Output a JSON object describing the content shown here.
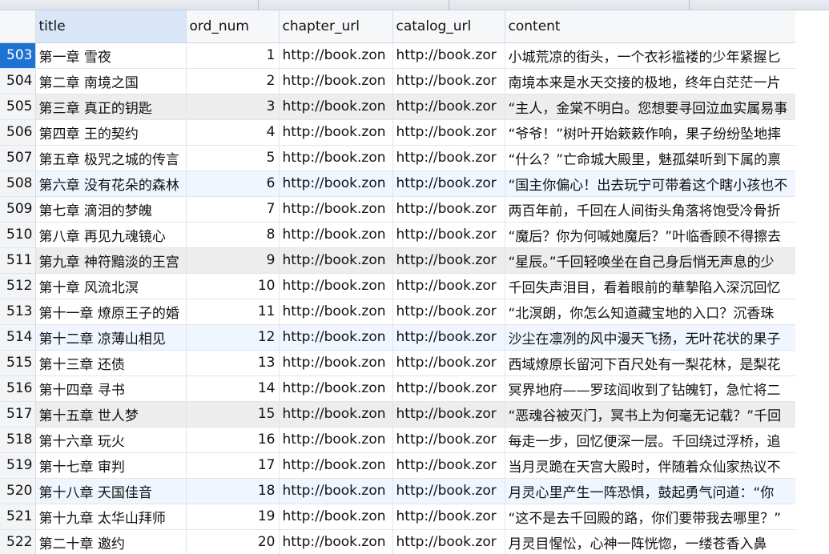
{
  "toolbar": {
    "fragments": [
      "",
      "",
      ""
    ]
  },
  "columns": [
    "",
    "title",
    "ord_num",
    "chapter_url",
    "catalog_url",
    "content"
  ],
  "rows": [
    {
      "id": "503",
      "title": "第一章 雪夜",
      "ord": "1",
      "chapter_url": "http://book.zon",
      "catalog_url": "http://book.zor",
      "content": "小城荒凉的街头，一个衣衫褴褛的少年紧握匕",
      "style": "sel"
    },
    {
      "id": "504",
      "title": "第二章 南境之国",
      "ord": "2",
      "chapter_url": "http://book.zon",
      "catalog_url": "http://book.zor",
      "content": "南境本来是水天交接的极地，终年白茫茫一片",
      "style": ""
    },
    {
      "id": "505",
      "title": "第三章 真正的钥匙",
      "ord": "3",
      "chapter_url": "http://book.zon",
      "catalog_url": "http://book.zor",
      "content": "“主人，金棠不明白。您想要寻回泣血实属易事",
      "style": "grey"
    },
    {
      "id": "506",
      "title": "第四章 王的契约",
      "ord": "4",
      "chapter_url": "http://book.zon",
      "catalog_url": "http://book.zor",
      "content": "“爷爷！”树叶开始簌簌作响，果子纷纷坠地摔",
      "style": ""
    },
    {
      "id": "507",
      "title": "第五章 极咒之城的传言",
      "ord": "5",
      "chapter_url": "http://book.zon",
      "catalog_url": "http://book.zor",
      "content": "“什么？”亡命城大殿里，魅孤桀听到下属的禀",
      "style": ""
    },
    {
      "id": "508",
      "title": "第六章 没有花朵的森林",
      "ord": "6",
      "chapter_url": "http://book.zon",
      "catalog_url": "http://book.zor",
      "content": "“国主你偏心！出去玩宁可带着这个瞎小孩也不",
      "style": "alt"
    },
    {
      "id": "509",
      "title": "第七章 滴泪的梦魄",
      "ord": "7",
      "chapter_url": "http://book.zon",
      "catalog_url": "http://book.zor",
      "content": "两百年前，千回在人间街头角落将饱受冷骨折",
      "style": ""
    },
    {
      "id": "510",
      "title": "第八章 再见九魂镜心",
      "ord": "8",
      "chapter_url": "http://book.zon",
      "catalog_url": "http://book.zor",
      "content": "“魔后？你为何喊她魔后？”叶临香顾不得擦去",
      "style": ""
    },
    {
      "id": "511",
      "title": "第九章 神符黯淡的王宫",
      "ord": "9",
      "chapter_url": "http://book.zon",
      "catalog_url": "http://book.zor",
      "content": "“星辰。”千回轻唤坐在自己身后悄无声息的少",
      "style": "grey"
    },
    {
      "id": "512",
      "title": "第十章 风流北溟",
      "ord": "10",
      "chapter_url": "http://book.zon",
      "catalog_url": "http://book.zor",
      "content": "千回失声泪目，看着眼前的華摯陷入深沉回忆",
      "style": ""
    },
    {
      "id": "513",
      "title": "第十一章 燎原王子的婚",
      "ord": "11",
      "chapter_url": "http://book.zon",
      "catalog_url": "http://book.zor",
      "content": "“北溟朗，你怎么知道藏宝地的入口？沉香珠",
      "style": ""
    },
    {
      "id": "514",
      "title": "第十二章 凉薄山相见",
      "ord": "12",
      "chapter_url": "http://book.zon",
      "catalog_url": "http://book.zor",
      "content": "沙尘在凛冽的风中漫天飞扬，无叶花状的果子",
      "style": "alt"
    },
    {
      "id": "515",
      "title": "第十三章 还债",
      "ord": "13",
      "chapter_url": "http://book.zon",
      "catalog_url": "http://book.zor",
      "content": "西域燎原长留河下百尺处有一梨花林，是梨花",
      "style": ""
    },
    {
      "id": "516",
      "title": "第十四章 寻书",
      "ord": "14",
      "chapter_url": "http://book.zon",
      "catalog_url": "http://book.zor",
      "content": "冥界地府——罗玹阎收到了钻魄钉，急忙将二",
      "style": ""
    },
    {
      "id": "517",
      "title": "第十五章 世人梦",
      "ord": "15",
      "chapter_url": "http://book.zon",
      "catalog_url": "http://book.zor",
      "content": "“恶魂谷被灭门，冥书上为何毫无记载？”千回",
      "style": "grey"
    },
    {
      "id": "518",
      "title": "第十六章 玩火",
      "ord": "16",
      "chapter_url": "http://book.zon",
      "catalog_url": "http://book.zor",
      "content": "每走一步，回忆便深一层。千回绕过浮桥，追",
      "style": ""
    },
    {
      "id": "519",
      "title": "第十七章 审判",
      "ord": "17",
      "chapter_url": "http://book.zon",
      "catalog_url": "http://book.zor",
      "content": "当月灵跪在天宫大殿时，伴随着众仙家热议不",
      "style": ""
    },
    {
      "id": "520",
      "title": "第十八章 天国佳音",
      "ord": "18",
      "chapter_url": "http://book.zon",
      "catalog_url": "http://book.zor",
      "content": "月灵心里产生一阵恐惧，鼓起勇气问道：“你",
      "style": "alt"
    },
    {
      "id": "521",
      "title": "第十九章 太华山拜师",
      "ord": "19",
      "chapter_url": "http://book.zon",
      "catalog_url": "http://book.zor",
      "content": "“这不是去千回殿的路，你们要带我去哪里？”",
      "style": ""
    },
    {
      "id": "522",
      "title": "第二十章 邀约",
      "ord": "20",
      "chapter_url": "http://book.zon",
      "catalog_url": "http://book.zor",
      "content": "月灵目惺忪，心神一阵恍惚，一缕苍香入鼻",
      "style": ""
    }
  ]
}
